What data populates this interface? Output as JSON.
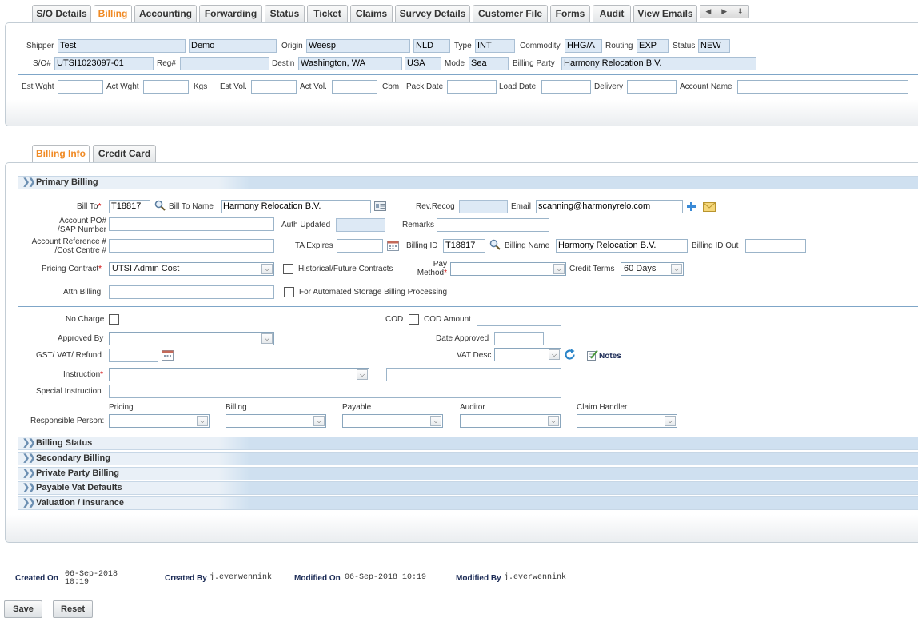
{
  "top_tabs": [
    "S/O Details",
    "Billing",
    "Accounting",
    "Forwarding",
    "Status",
    "Ticket",
    "Claims",
    "Survey Details",
    "Customer File",
    "Forms",
    "Audit",
    "View Emails"
  ],
  "header": {
    "shipper_label": "Shipper",
    "shipper_first": "Test",
    "shipper_last": "Demo",
    "origin_label": "Origin",
    "origin": "Weesp",
    "origin_country": "NLD",
    "type_label": "Type",
    "type": "INT",
    "commodity_label": "Commodity",
    "commodity": "HHG/A",
    "routing_label": "Routing",
    "routing": "EXP",
    "status_label": "Status",
    "status": "NEW",
    "so_label": "S/O#",
    "so": "UTSI1023097-01",
    "reg_label": "Reg#",
    "reg": "",
    "destin_label": "Destin",
    "destin": "Washington, WA",
    "destin_country": "USA",
    "mode_label": "Mode",
    "mode": "Sea",
    "billing_party_label": "Billing Party",
    "billing_party": "Harmony Relocation B.V.",
    "est_wght_label": "Est Wght",
    "act_wght_label": "Act Wght",
    "kgs_label": "Kgs",
    "est_vol_label": "Est Vol.",
    "act_vol_label": "Act Vol.",
    "cbm_label": "Cbm",
    "pack_date_label": "Pack Date",
    "load_date_label": "Load Date",
    "delivery_label": "Delivery",
    "account_name_label": "Account Name"
  },
  "sub_tabs": [
    "Billing Info",
    "Credit Card"
  ],
  "sections": {
    "primary": "Primary Billing",
    "billing_status": "Billing Status",
    "secondary": "Secondary Billing",
    "private_party": "Private Party Billing",
    "payable_vat": "Payable Vat Defaults",
    "valuation": "Valuation / Insurance"
  },
  "primary": {
    "bill_to_label": "Bill To",
    "bill_to": "T18817",
    "bill_to_name_label": "Bill To Name",
    "bill_to_name": "Harmony Relocation B.V.",
    "rev_recog_label": "Rev.Recog",
    "email_label": "Email",
    "email": "scanning@harmonyrelo.com",
    "account_po_label_1": "Account PO#",
    "account_po_label_2": "/SAP Number",
    "auth_updated_label": "Auth Updated",
    "remarks_label": "Remarks",
    "account_ref_label_1": "Account Reference #",
    "account_ref_label_2": "/Cost Centre #",
    "ta_expires_label": "TA Expires",
    "billing_id_label": "Billing ID",
    "billing_id": "T18817",
    "billing_name_label": "Billing Name",
    "billing_name": "Harmony Relocation B.V.",
    "billing_id_out_label": "Billing ID Out",
    "pricing_contract_label": "Pricing Contract",
    "pricing_contract": "UTSI Admin Cost",
    "historical_label": "Historical/Future Contracts",
    "pay_method_label_1": "Pay",
    "pay_method_label_2": "Method",
    "credit_terms_label": "Credit Terms",
    "credit_terms": "60 Days",
    "attn_billing_label": "Attn Billing",
    "automated_storage_label": "For Automated Storage Billing Processing",
    "no_charge_label": "No Charge",
    "cod_label": "COD",
    "cod_amount_label": "COD Amount",
    "approved_by_label": "Approved By",
    "date_approved_label": "Date Approved",
    "gst_label": "GST/ VAT/ Refund",
    "vat_desc_label": "VAT Desc",
    "notes_label": "Notes",
    "instruction_label": "Instruction",
    "special_instruction_label": "Special Instruction",
    "responsible_person_label": "Responsible Person:",
    "resp_cols": [
      "Pricing",
      "Billing",
      "Payable",
      "Auditor",
      "Claim Handler"
    ]
  },
  "footer": {
    "created_on_label": "Created On",
    "created_on_date": "06-Sep-2018",
    "created_on_time": "10:19",
    "created_by_label": "Created By",
    "created_by": "j.everwennink",
    "modified_on_label": "Modified On",
    "modified_on": "06-Sep-2018 10:19",
    "modified_by_label": "Modified By",
    "modified_by": "j.everwennink"
  },
  "buttons": {
    "save": "Save",
    "reset": "Reset"
  },
  "colors": {
    "active_tab": "#f08a24",
    "section_bar": "#cfe0f0",
    "readonly_field": "#dde9f5",
    "required": "#d00000"
  }
}
